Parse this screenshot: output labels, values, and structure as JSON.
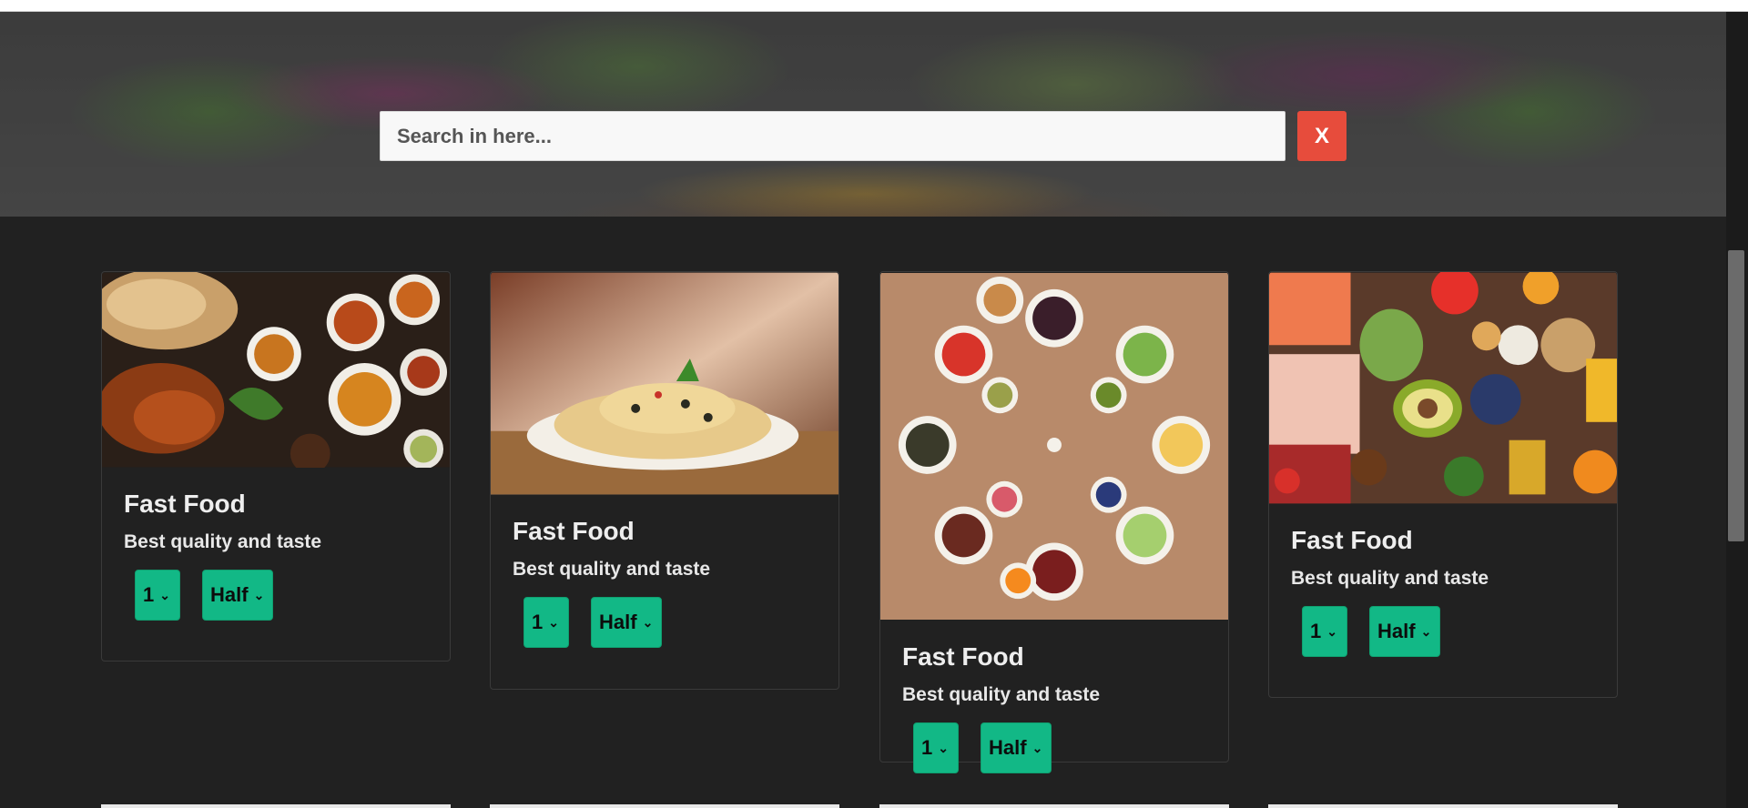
{
  "search": {
    "placeholder": "Search in here...",
    "close_label": "X"
  },
  "cards": [
    {
      "title": "Fast Food",
      "subtitle": "Best quality and taste",
      "qty": "1",
      "size": "Half",
      "image": "indian-curry-spread"
    },
    {
      "title": "Fast Food",
      "subtitle": "Best quality and taste",
      "qty": "1",
      "size": "Half",
      "image": "spaghetti-plate"
    },
    {
      "title": "Fast Food",
      "subtitle": "Best quality and taste",
      "qty": "1",
      "size": "Half",
      "image": "healthy-bowls-circle"
    },
    {
      "title": "Fast Food",
      "subtitle": "Best quality and taste",
      "qty": "1",
      "size": "Half",
      "image": "fresh-produce-assortment"
    }
  ],
  "colors": {
    "accent": "#12b886",
    "close": "#e74c3c",
    "background": "#212121"
  }
}
